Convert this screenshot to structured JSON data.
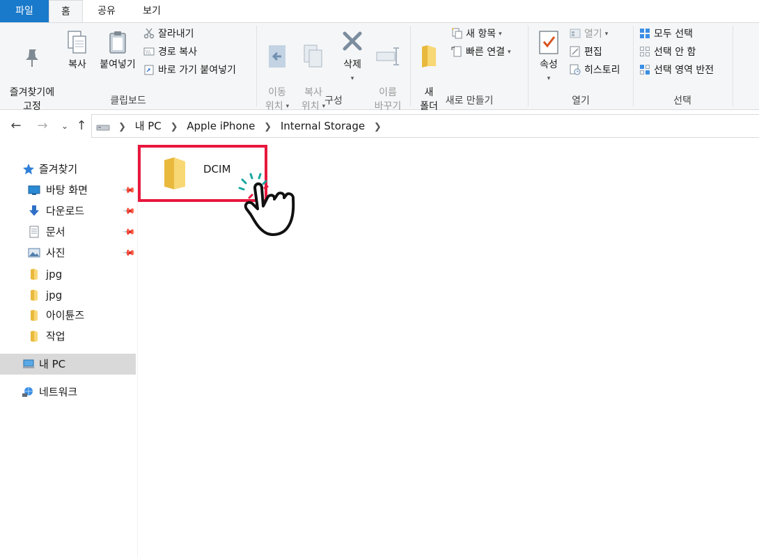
{
  "tabs": {
    "file": "파일",
    "home": "홈",
    "share": "공유",
    "view": "보기"
  },
  "ribbon": {
    "clipboard": {
      "label": "클립보드",
      "pin": "즐겨찾기에\n고정",
      "copy": "복사",
      "paste": "붙여넣기",
      "cut": "잘라내기",
      "copy_path": "경로 복사",
      "paste_shortcut": "바로 가기 붙여넣기"
    },
    "organize": {
      "label": "구성",
      "move_to": "이동\n위치",
      "copy_to": "복사\n위치",
      "delete": "삭제",
      "rename": "이름\n바꾸기"
    },
    "new": {
      "label": "새로 만들기",
      "new_folder": "새\n폴더",
      "new_item": "새 항목",
      "easy_access": "빠른 연결"
    },
    "open": {
      "label": "열기",
      "properties": "속성",
      "open": "열기",
      "edit": "편집",
      "history": "히스토리"
    },
    "select": {
      "label": "선택",
      "select_all": "모두 선택",
      "select_none": "선택 안 함",
      "invert": "선택 영역 반전"
    }
  },
  "address": {
    "crumbs": [
      "내 PC",
      "Apple iPhone",
      "Internal Storage"
    ]
  },
  "sidebar": {
    "favorites": "즐겨찾기",
    "items": [
      {
        "label": "바탕 화면",
        "icon": "desktop-icon",
        "pinned": true
      },
      {
        "label": "다운로드",
        "icon": "download-icon",
        "pinned": true
      },
      {
        "label": "문서",
        "icon": "document-icon",
        "pinned": true
      },
      {
        "label": "사진",
        "icon": "picture-icon",
        "pinned": true
      },
      {
        "label": "jpg",
        "icon": "folder-icon",
        "pinned": false
      },
      {
        "label": "jpg",
        "icon": "folder-icon",
        "pinned": false
      },
      {
        "label": "아이튠즈",
        "icon": "folder-icon",
        "pinned": false
      },
      {
        "label": "작업",
        "icon": "folder-icon",
        "pinned": false
      }
    ],
    "this_pc": "내 PC",
    "network": "네트워크"
  },
  "content": {
    "folders": [
      {
        "name": "DCIM",
        "highlighted": true
      }
    ]
  },
  "colors": {
    "file_tab": "#1979ca",
    "highlight_border": "#e8173c",
    "folder": "#f8d775",
    "selected_row": "#d9d9d9"
  }
}
